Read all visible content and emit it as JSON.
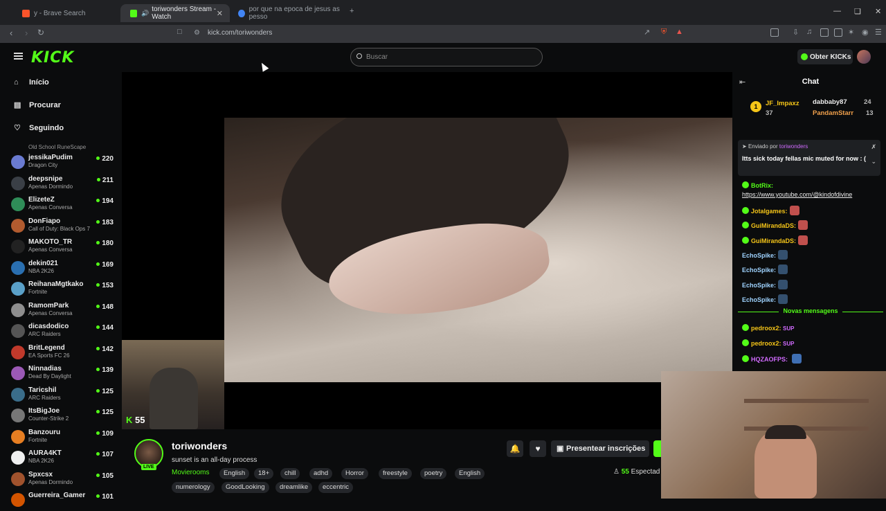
{
  "browser": {
    "tabs": [
      {
        "label": "y - Brave Search"
      },
      {
        "label": "toriwonders Stream - Watch"
      },
      {
        "label": "por que na epoca de jesus as pesso"
      }
    ],
    "url": "kick.com/toriwonders"
  },
  "header": {
    "logo": "KICK",
    "search_placeholder": "Buscar",
    "get_kicks": "Obter KICKs"
  },
  "sidebar": {
    "nav": [
      {
        "label": "Início"
      },
      {
        "label": "Procurar"
      },
      {
        "label": "Seguindo"
      }
    ],
    "partial_category": "Old School RuneScape",
    "channels": [
      {
        "name": "jessikaPudim",
        "category": "Dragon City",
        "viewers": "220",
        "color": "#6a7bd1"
      },
      {
        "name": "deepsnipe",
        "category": "Apenas Dormindo",
        "viewers": "211",
        "color": "#3a3f46"
      },
      {
        "name": "ElizeteZ",
        "category": "Apenas Conversa",
        "viewers": "194",
        "color": "#2f8d58"
      },
      {
        "name": "DonFiapo",
        "category": "Call of Duty: Black Ops 7",
        "viewers": "183",
        "color": "#b15b2f"
      },
      {
        "name": "MAKOTO_TR",
        "category": "Apenas Conversa",
        "viewers": "180",
        "color": "#222"
      },
      {
        "name": "dekin021",
        "category": "NBA 2K26",
        "viewers": "169",
        "color": "#2a6fb0"
      },
      {
        "name": "ReihanaMgtkako",
        "category": "Fortnite",
        "viewers": "153",
        "color": "#5aa0c8"
      },
      {
        "name": "RamomPark",
        "category": "Apenas Conversa",
        "viewers": "148",
        "color": "#8e8e8e"
      },
      {
        "name": "dicasdodico",
        "category": "ARC Raiders",
        "viewers": "144",
        "color": "#555"
      },
      {
        "name": "BritLegend",
        "category": "EA Sports FC 26",
        "viewers": "142",
        "color": "#c0392b"
      },
      {
        "name": "Ninnadias",
        "category": "Dead By Daylight",
        "viewers": "139",
        "color": "#9b59b6"
      },
      {
        "name": "Taricshil",
        "category": "ARC Raiders",
        "viewers": "125",
        "color": "#3a6d8a"
      },
      {
        "name": "ItsBigJoe",
        "category": "Counter-Strike 2",
        "viewers": "125",
        "color": "#777"
      },
      {
        "name": "Banzouru",
        "category": "Fortnite",
        "viewers": "109",
        "color": "#e67e22"
      },
      {
        "name": "AURA4KT",
        "category": "NBA 2K26",
        "viewers": "107",
        "color": "#f0f0f0"
      },
      {
        "name": "Spxcsx",
        "category": "Apenas Dormindo",
        "viewers": "105",
        "color": "#a0522d"
      },
      {
        "name": "Guerreira_Gamer",
        "category": "",
        "viewers": "101",
        "color": "#d35400"
      }
    ]
  },
  "player": {
    "cam_badge": "55"
  },
  "stream": {
    "streamer": "toriwonders",
    "title": "sunset is an all-day process",
    "category": "Movierooms",
    "tags": [
      "English",
      "18+",
      "chill",
      "adhd",
      "Horror",
      "freestyle",
      "poetry",
      "English"
    ],
    "tags2": [
      "numerology",
      "GoodLooking",
      "dreamlike",
      "eccentric"
    ],
    "live_badge": "LIVE",
    "gift_label": "Presentear inscrições",
    "viewers_count": "55",
    "viewers_label": "Espectad"
  },
  "chat": {
    "title": "Chat",
    "gifters": [
      {
        "name": "JF_Impaxz",
        "count": "37"
      },
      {
        "name": "dabbaby87",
        "count": "24"
      },
      {
        "name": "PandamStarr",
        "count": "13"
      }
    ],
    "pinned_by_label": "Enviado por",
    "pinned_by_user": "toriwonders",
    "pinned_message": "Itts sick today fellas mic muted for now : (",
    "messages": [
      {
        "user": "BotRix:",
        "color": "#53fc18",
        "text": "https://www.youtube.com/@kindofdivine"
      },
      {
        "user": "Jotalgames:",
        "color": "#f5c518",
        "text": ""
      },
      {
        "user": "GuiMirandaDS:",
        "color": "#f5c518",
        "text": ""
      },
      {
        "user": "GuiMirandaDS:",
        "color": "#f5c518",
        "text": ""
      },
      {
        "user": "EchoSpike:",
        "color": "#9fd3ff",
        "text": ""
      },
      {
        "user": "EchoSpike:",
        "color": "#9fd3ff",
        "text": ""
      },
      {
        "user": "EchoSpike:",
        "color": "#9fd3ff",
        "text": ""
      },
      {
        "user": "EchoSpike:",
        "color": "#9fd3ff",
        "text": ""
      }
    ],
    "new_messages_label": "Novas mensagens",
    "messages_after": [
      {
        "user": "pedroox2:",
        "color": "#f5c518",
        "text": "SUP"
      },
      {
        "user": "pedroox2:",
        "color": "#f5c518",
        "text": "SUP"
      },
      {
        "user": "HQZAOFPS:",
        "color": "#d16bff",
        "text": ""
      }
    ]
  },
  "colors": {
    "accent": "#53fc18"
  }
}
